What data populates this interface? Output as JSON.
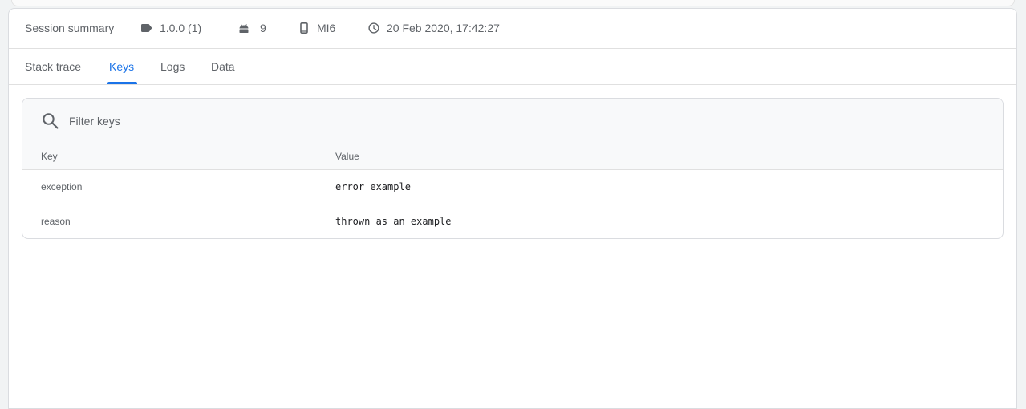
{
  "summary": {
    "title": "Session summary",
    "version": "1.0.0 (1)",
    "os_version": "9",
    "device": "MI6",
    "timestamp": "20 Feb 2020, 17:42:27"
  },
  "tabs": [
    {
      "label": "Stack trace",
      "active": false
    },
    {
      "label": "Keys",
      "active": true
    },
    {
      "label": "Logs",
      "active": false
    },
    {
      "label": "Data",
      "active": false
    }
  ],
  "keys_panel": {
    "filter_placeholder": "Filter keys",
    "filter_value": "",
    "columns": {
      "key": "Key",
      "value": "Value"
    },
    "rows": [
      {
        "key": "exception",
        "value": "error_example"
      },
      {
        "key": "reason",
        "value": "thrown as an example"
      }
    ]
  },
  "icons": {
    "version": "label-icon",
    "os": "android-icon",
    "device": "phone-icon",
    "time": "clock-icon",
    "search": "search-icon"
  },
  "colors": {
    "accent": "#1a73e8",
    "text_secondary": "#5f6368",
    "text_primary": "#202124"
  }
}
